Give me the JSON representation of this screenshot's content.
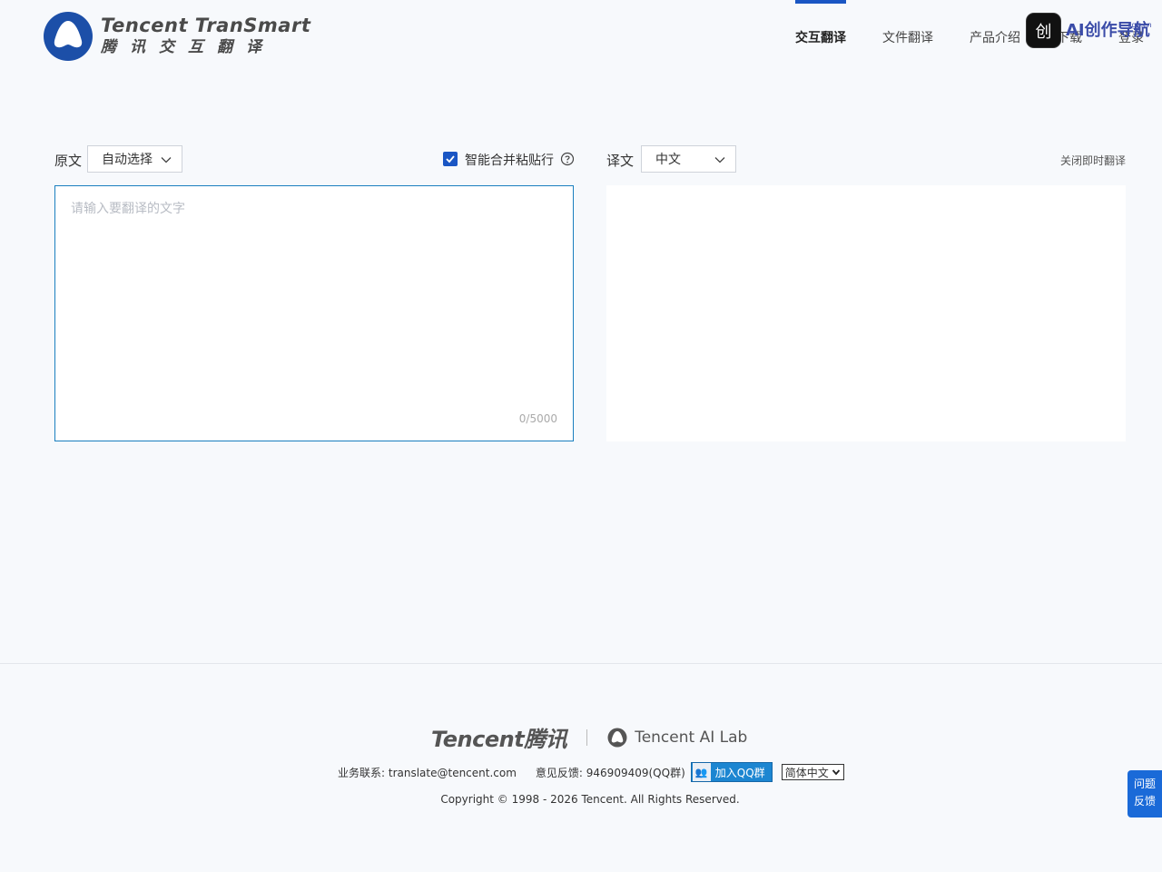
{
  "header": {
    "logo_en": "Tencent TranSmart",
    "logo_cn": "腾讯交互翻译",
    "nav": [
      {
        "label": "交互翻译",
        "active": true
      },
      {
        "label": "文件翻译",
        "active": false
      },
      {
        "label": "产品介绍",
        "active": false
      },
      {
        "label": "下载",
        "active": false
      },
      {
        "label": "登录",
        "active": false
      }
    ],
    "ai_badge": {
      "text": "AI创作导航",
      "sub": "cgn.cn",
      "icon": "创"
    }
  },
  "source": {
    "label": "原文",
    "lang_select": "自动选择",
    "smart_merge_label": "智能合并粘贴行",
    "smart_merge_checked": true,
    "placeholder": "请输入要翻译的文字",
    "counter": "0/5000"
  },
  "target": {
    "label": "译文",
    "lang_select": "中文",
    "close_instant": "关闭即时翻译"
  },
  "footer": {
    "tencent_logo": "Tencent腾讯",
    "ailab": "Tencent AI Lab",
    "business_contact": "业务联系: translate@tencent.com",
    "feedback_contact": "意见反馈: 946909409(QQ群)",
    "qq_button": "加入QQ群",
    "language_select": "简体中文",
    "copyright": "Copyright © 1998 - 2026 Tencent. All Rights Reserved."
  },
  "feedback_float": {
    "line1": "问题",
    "line2": "反馈"
  },
  "colors": {
    "accent": "#1a56c4",
    "border_focus": "#1a7fbf",
    "background": "#f7f9fc"
  }
}
